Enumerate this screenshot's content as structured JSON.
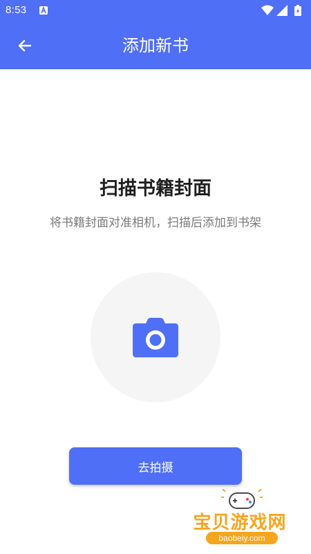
{
  "status_bar": {
    "time": "8:53",
    "app_icon": "a-icon",
    "icons": [
      "wifi-icon",
      "signal-icon",
      "battery-icon"
    ]
  },
  "toolbar": {
    "back_icon": "arrow-left-icon",
    "title": "添加新书"
  },
  "main": {
    "headline": "扫描书籍封面",
    "subtitle": "将书籍封面对准相机，扫描后添加到书架",
    "camera_icon": "camera-icon",
    "capture_button_label": "去拍摄"
  },
  "watermark": {
    "text": "宝贝游戏网",
    "url": "baobeiy.com"
  },
  "colors": {
    "primary": "#4f6ff6",
    "circle_bg": "#f5f5f5",
    "headline": "#1f1f1f",
    "subtitle": "#7a7a7a",
    "watermark": "#f6a51e"
  }
}
